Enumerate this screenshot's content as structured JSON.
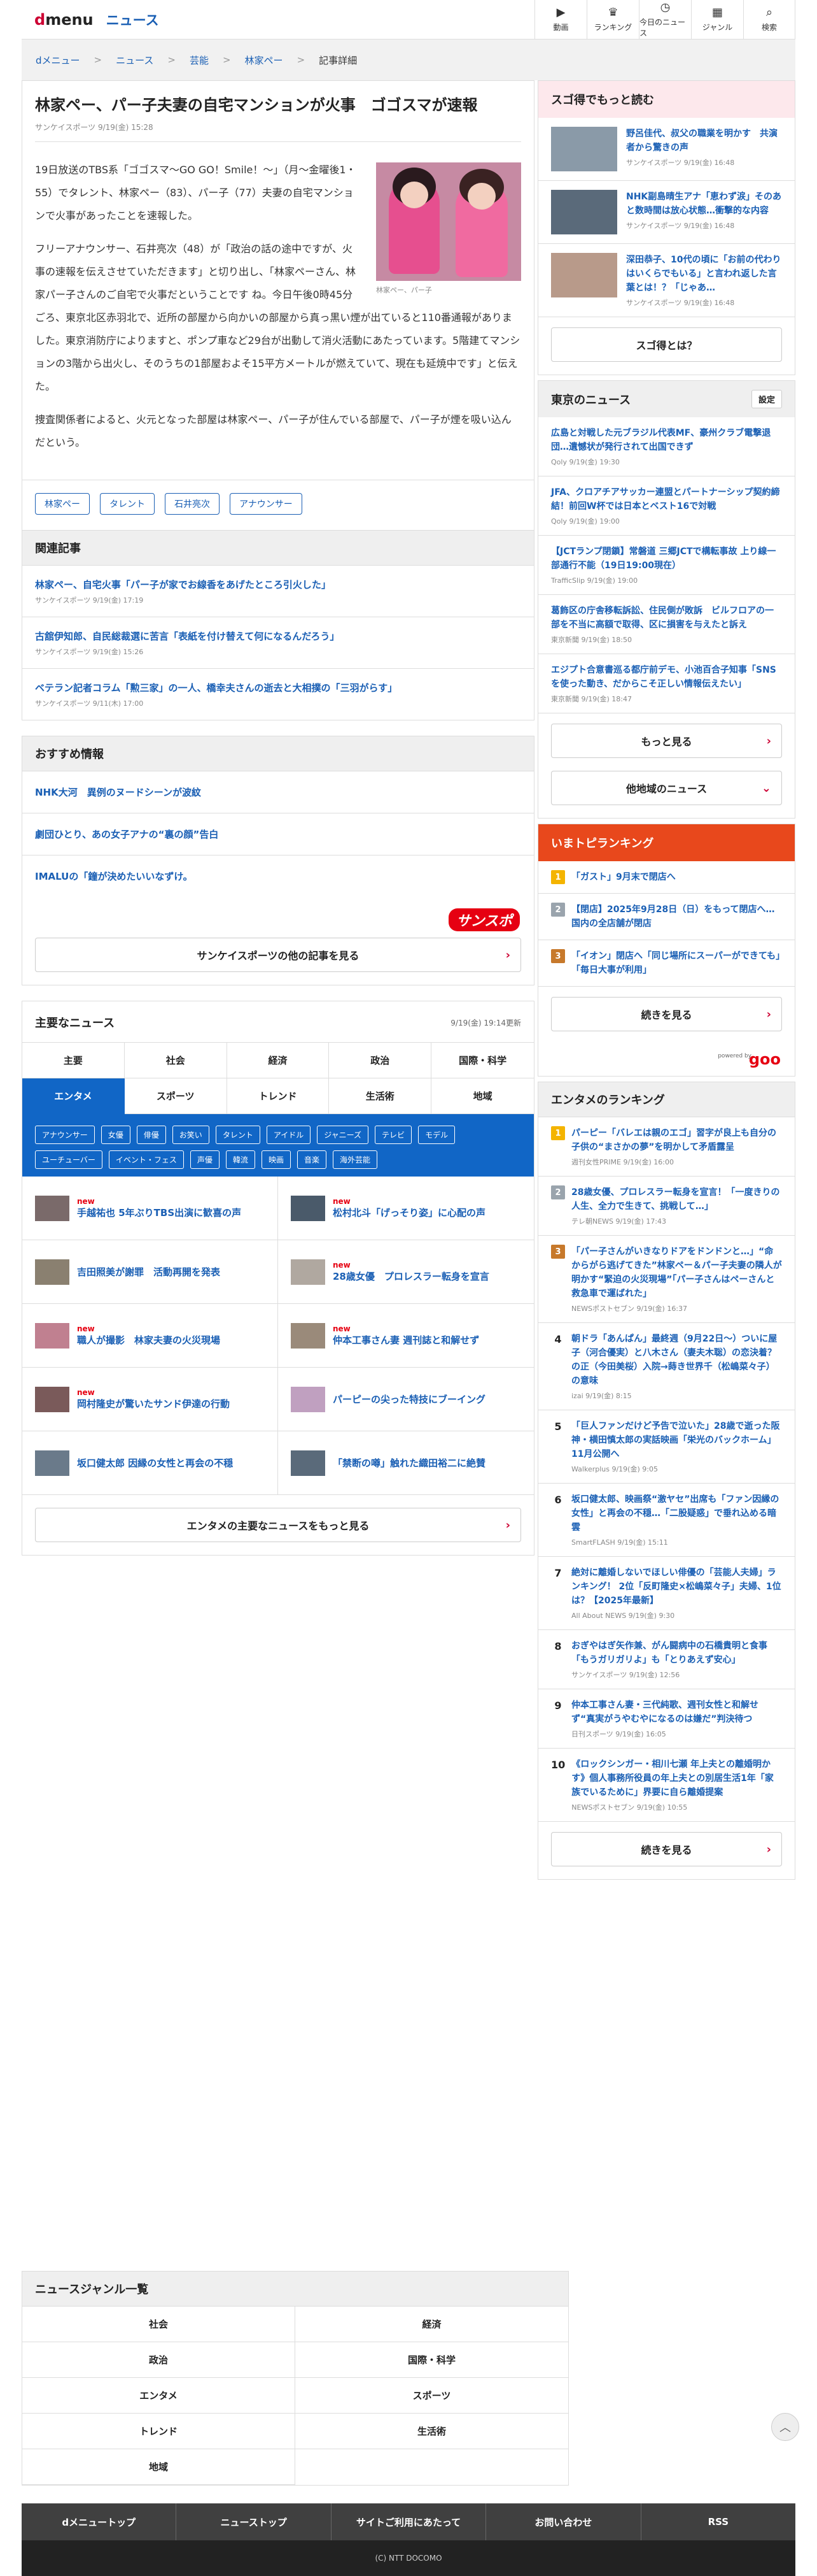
{
  "header": {
    "logo_d": "d",
    "logo_rest": "menu",
    "section": "ニュース",
    "nav": [
      {
        "icon": "▶",
        "label": "動画"
      },
      {
        "icon": "♛",
        "label": "ランキング"
      },
      {
        "icon": "◷",
        "label": "今日のニュース"
      },
      {
        "icon": "▦",
        "label": "ジャンル"
      },
      {
        "icon": "⌕",
        "label": "検索"
      }
    ]
  },
  "breadcrumb": [
    "dメニュー",
    "ニュース",
    "芸能",
    "林家ペー",
    "記事詳細"
  ],
  "article": {
    "title": "林家ペー、パー子夫妻の自宅マンションが火事　ゴゴスマが速報",
    "meta": "サンケイスポーツ 9/19(金) 15:28",
    "photo_caption": "林家ペー、パー子",
    "paragraphs": [
      "19日放送のTBS系「ゴゴスマ～GO GO！Smile！～」（月～金曜後1・55）でタレント、林家ペー（83）、パー子（77）夫妻の自宅マンションで火事があったことを速報した。",
      "フリーアナウンサー、石井亮次（48）が「政治の話の途中ですが、火事の速報を伝えさせていただきます」と切り出し、「林家ペーさん、林家パー子さんのご自宅で火事だということです ね。今日午後0時45分ごろ、東京北区赤羽北で、近所の部屋から向かいの部屋から真っ黒い煙が出ていると110番通報がありました。東京消防庁によりますと、ポンプ車など29台が出動して消火活動にあたっています。5階建てマンションの3階から出火し、そのうちの1部屋およそ15平方メートルが燃えていて、現在も延焼中です」と伝えた。",
      "捜査関係者によると、火元となった部屋は林家ペー、パー子が住んでいる部屋で、パー子が煙を吸い込んだという。"
    ],
    "tags": [
      "林家ペー",
      "タレント",
      "石井亮次",
      "アナウンサー"
    ]
  },
  "related": {
    "heading": "関連記事",
    "items": [
      {
        "title": "林家ペー、自宅火事「パー子が家でお線香をあげたところ引火した」",
        "meta": "サンケイスポーツ 9/19(金) 17:19"
      },
      {
        "title": "古舘伊知郎、自民総裁選に苦言「表紙を付け替えて何になるんだろう」",
        "meta": "サンケイスポーツ 9/19(金) 15:26"
      },
      {
        "title": "ベテラン記者コラム「勲三家」の一人、橋幸夫さんの逝去と大相撲の「三羽がらす」",
        "meta": "サンケイスポーツ 9/11(木) 17:00"
      }
    ]
  },
  "recommend": {
    "heading": "おすすめ情報",
    "items": [
      "NHK大河　異例のヌードシーンが波紋",
      "劇団ひとり、あの女子アナの“裏の顔”告白",
      "IMALUの「鐘が決めたいいなずけ。"
    ],
    "logo": "サンスポ",
    "more": "サンケイスポーツの他の記事を見る"
  },
  "major": {
    "heading": "主要なニュース",
    "updated": "9/19(金) 19:14更新",
    "tabs": [
      "主要",
      "社会",
      "経済",
      "政治",
      "国際・科学",
      "エンタメ",
      "スポーツ",
      "トレンド",
      "生活術",
      "地域"
    ],
    "subtags": [
      "アナウンサー",
      "女優",
      "俳優",
      "お笑い",
      "タレント",
      "アイドル",
      "ジャニーズ",
      "テレビ",
      "モデル",
      "ユーチューバー",
      "イベント・フェス",
      "声優",
      "韓流",
      "映画",
      "音楽",
      "海外芸能"
    ],
    "new_label": "new",
    "news": [
      {
        "title": "手越祐也 5年ぶりTBS出演に歓喜の声",
        "new": true
      },
      {
        "title": "松村北斗「げっそり姿」に心配の声",
        "new": true
      },
      {
        "title": "吉田照美が謝罪　活動再開を発表",
        "new": false
      },
      {
        "title": "28歳女優　プロレスラー転身を宣言",
        "new": true
      },
      {
        "title": "職人が撮影　林家夫妻の火災現場",
        "new": true
      },
      {
        "title": "仲本工事さん妻 週刊誌と和解せず",
        "new": true
      },
      {
        "title": "岡村隆史が驚いたサンド伊達の行動",
        "new": true
      },
      {
        "title": "パーピーの尖った特技にブーイング",
        "new": false
      },
      {
        "title": "坂口健太郎 因縁の女性と再会の不穏",
        "new": false
      },
      {
        "title": "「禁断の噂」触れた織田裕二に絶賛",
        "new": false
      }
    ],
    "more": "エンタメの主要なニュースをもっと見る"
  },
  "sidebar": {
    "sugotoku": {
      "heading": "スゴ得でもっと読む",
      "items": [
        {
          "title": "野呂佳代、叔父の職業を明かす　共演者から驚きの声",
          "meta": "サンケイスポーツ 9/19(金) 16:48"
        },
        {
          "title": "NHK副島晴生アナ「恵わず涙」そのあと数時間は放心状態…衝撃的な内容",
          "meta": "サンケイスポーツ 9/19(金) 16:48"
        },
        {
          "title": "深田恭子、10代の頃に「お前の代わりはいくらでもいる」と言われ返した言葉とは！？「じゃあ…",
          "meta": "サンケイスポーツ 9/19(金) 16:48"
        }
      ],
      "button": "スゴ得とは？"
    },
    "tokyo": {
      "heading": "東京のニュース",
      "setting": "設定",
      "items": [
        {
          "title": "広島と対戦した元ブラジル代表MF、豪州クラブ電撃退団…遺憾状が発行されて出国できず",
          "meta": "Qoly 9/19(金) 19:30"
        },
        {
          "title": "JFA、クロアチアサッカー連盟とパートナーシップ契約締結！前回W杯では日本とベスト16で対戦",
          "meta": "Qoly 9/19(金) 19:00"
        },
        {
          "title": "【JCTランプ閉鎖】常磐道 三郷JCTで構転事故 上り線一部通行不能（19日19:00現在）",
          "meta": "TrafficSlip 9/19(金) 19:00"
        },
        {
          "title": "葛飾区の庁舎移転訴訟、住民側が敗訴　ビルフロアの一部を不当に高額で取得、区に損害を与えたと訴え",
          "meta": "東京新聞 9/19(金) 18:50"
        },
        {
          "title": "エジプト合意書巡る都庁前デモ、小池百合子知事「SNSを使った動き、だからこそ正しい情報伝えたい」",
          "meta": "東京新聞 9/19(金) 18:47"
        }
      ],
      "more": "もっと見る",
      "other": "他地域のニュース"
    },
    "trend": {
      "heading": "いまトピランキング",
      "items": [
        {
          "rank": "1",
          "title": "「ガスト」9月末で閉店へ"
        },
        {
          "rank": "2",
          "title": "【閉店】2025年9月28日（日）をもって閉店へ…国内の全店舗が閉店"
        },
        {
          "rank": "3",
          "title": "「イオン」閉店へ「同じ場所にスーパーができても」「毎日大事が利用」"
        }
      ],
      "more": "続きを見る",
      "powered": "powered by",
      "logo": "goo"
    },
    "ent_rank": {
      "heading": "エンタメのランキング",
      "items": [
        {
          "rank": "1",
          "title": "パーピー「バレエは親のエゴ」習字が良上も自分の子供の“まさかの夢”を明かして矛盾露呈",
          "meta": "週刊女性PRIME 9/19(金) 16:00"
        },
        {
          "rank": "2",
          "title": "28歳女優、プロレスラー転身を宣言！「一度きりの人生、全力で生きて、挑戦して…」",
          "meta": "テレ朝NEWS 9/19(金) 17:43"
        },
        {
          "rank": "3",
          "title": "「パー子さんがいきなりドアをドンドンと…」“命からがら逃げてきた”林家ペー＆パー子夫妻の隣人が明かす“緊迫の火災現場”「パー子さんはペーさんと救急車で運ばれた」",
          "meta": "NEWSポストセブン 9/19(金) 16:37"
        },
        {
          "rank": "4",
          "title": "朝ドラ「あんぱん」最終週（9月22日〜）ついに屋子（河合優実）と八木さん（妻夫木聡）の恋決着？の正（今田美桜）入院→蒔き世界千（松嶋菜々子）の意味",
          "meta": "izai 9/19(金) 8:15"
        },
        {
          "rank": "5",
          "title": "「巨人ファンだけど予告で泣いた」28歳で逝った阪神・横田慎太郎の実話映画「栄光のバックホーム」11月公開へ",
          "meta": "Walkerplus 9/19(金) 9:05"
        },
        {
          "rank": "6",
          "title": "坂口健太郎、映画祭“激ヤセ”出席も「ファン因縁の女性」と再会の不穏…「二股疑惑」で垂れ込める暗雲",
          "meta": "SmartFLASH 9/19(金) 15:11"
        },
        {
          "rank": "7",
          "title": "絶対に離婚しないでほしい俳優の「芸能人夫婦」ランキング！ 2位「反町隆史×松嶋菜々子」夫婦、1位は？【2025年最新】",
          "meta": "All About NEWS 9/19(金) 9:30"
        },
        {
          "rank": "8",
          "title": "おぎやはぎ矢作兼、がん闘病中の石橋貴明と食事「もうガリガリよ」も「とりあえず安心」",
          "meta": "サンケイスポーツ 9/19(金) 12:56"
        },
        {
          "rank": "9",
          "title": "仲本工事さん妻・三代純歌、週刊女性と和解せず“真実がうやむやになるのは嫌だ”判決待つ",
          "meta": "日刊スポーツ 9/19(金) 16:05"
        },
        {
          "rank": "10",
          "title": "《ロックシンガー・相川七瀬 年上夫との離婚明かす》個人事務所役員の年上夫との別居生活1年「家族でいるために」界要に自ら離婚提案",
          "meta": "NEWSポストセブン 9/19(金) 10:55"
        }
      ],
      "more": "続きを見る"
    }
  },
  "genre": {
    "heading": "ニュースジャンル一覧",
    "items": [
      "社会",
      "経済",
      "政治",
      "国際・科学",
      "エンタメ",
      "スポーツ",
      "トレンド",
      "生活術",
      "地域"
    ]
  },
  "totop": "︿",
  "footer": {
    "nav": [
      "dメニュートップ",
      "ニューストップ",
      "サイトご利用にあたって",
      "お問い合わせ",
      "RSS"
    ],
    "copyright": "(C) NTT DOCOMO"
  }
}
